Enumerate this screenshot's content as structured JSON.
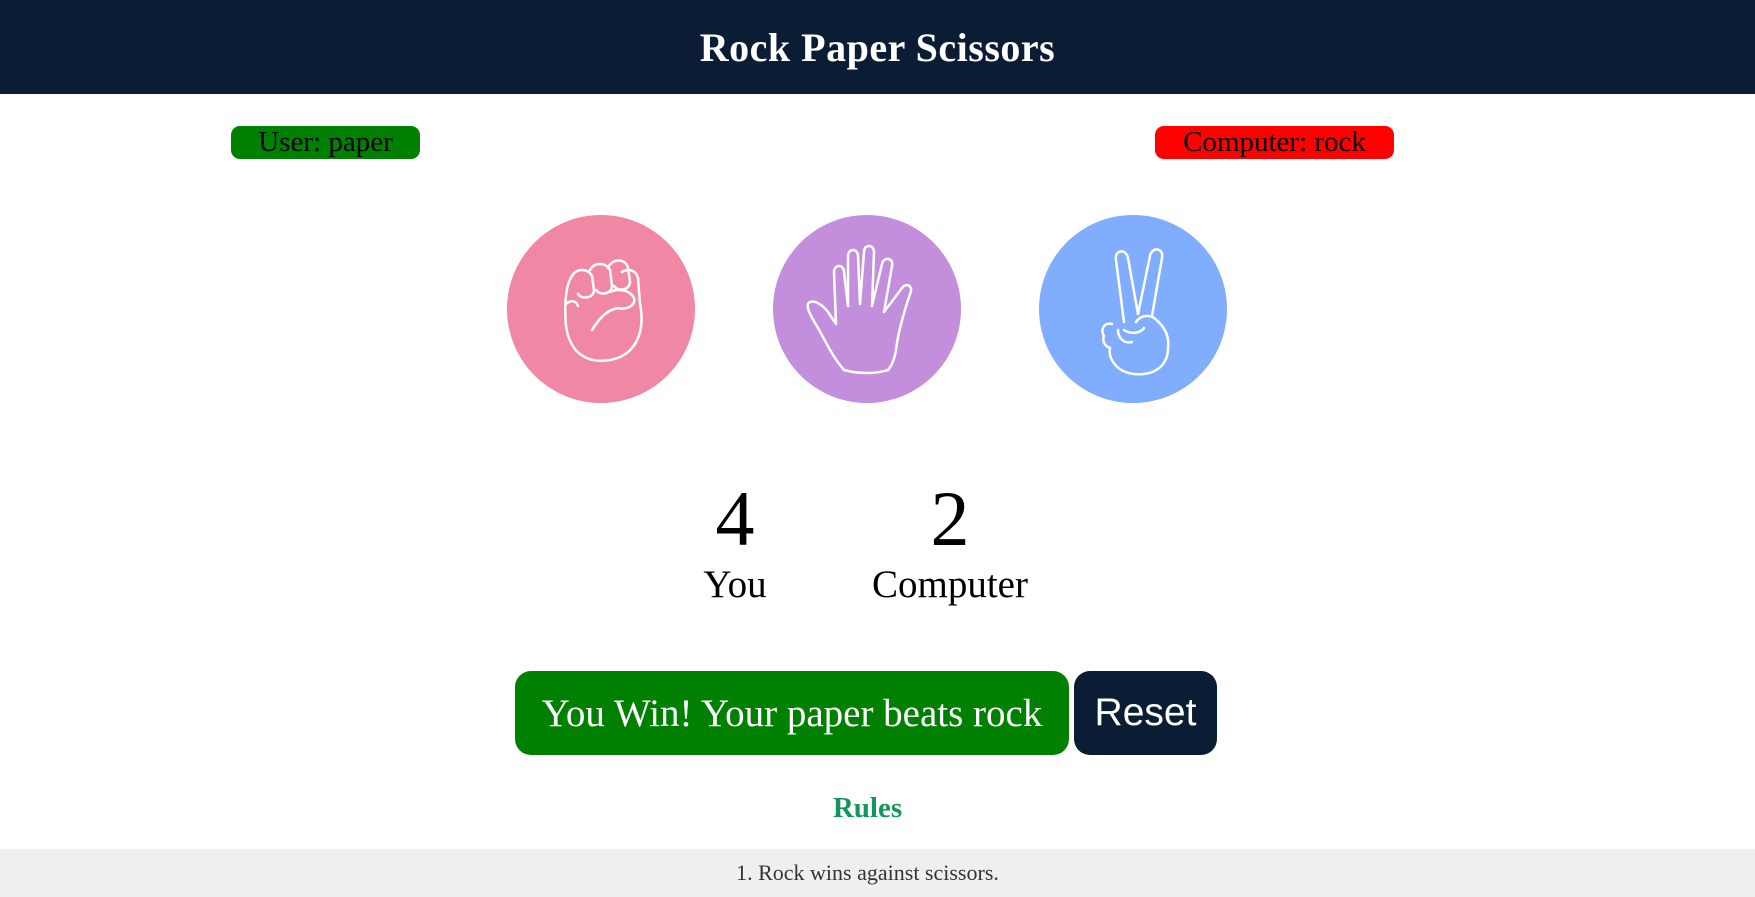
{
  "header": {
    "title": "Rock Paper Scissors"
  },
  "selection": {
    "user_label": "User: paper",
    "computer_label": "Computer: rock",
    "user_color": "#008000",
    "computer_color": "#ff0000"
  },
  "choices": [
    {
      "name": "rock",
      "icon": "fist-icon",
      "color": "#f087a5"
    },
    {
      "name": "paper",
      "icon": "open-hand-icon",
      "color": "#c38fdc"
    },
    {
      "name": "scissors",
      "icon": "peace-sign-icon",
      "color": "#80adfd"
    }
  ],
  "scores": {
    "user_score": "4",
    "user_label": "You",
    "computer_score": "2",
    "computer_label": "Computer"
  },
  "result": {
    "message": "You Win! Your paper beats rock",
    "color": "#008000"
  },
  "reset": {
    "label": "Reset"
  },
  "rules": {
    "title": "Rules",
    "items": [
      "1. Rock wins against scissors."
    ]
  },
  "colors": {
    "header_bg": "#0b1c35",
    "rules_title": "#139659"
  }
}
